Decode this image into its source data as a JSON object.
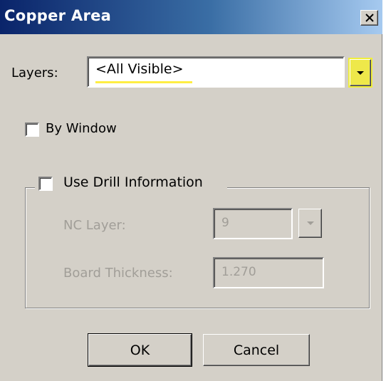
{
  "window": {
    "title": "Copper Area",
    "close_symbol": "×"
  },
  "layers": {
    "label": "Layers:",
    "value": "<All Visible>"
  },
  "by_window": {
    "label": "By Window",
    "checked": false
  },
  "drill_group": {
    "label": "Use Drill Information",
    "checked": false,
    "nc_layer": {
      "label": "NC Layer:",
      "value": "9"
    },
    "board_thickness": {
      "label": "Board Thickness:",
      "value": "1.270"
    }
  },
  "buttons": {
    "ok": "OK",
    "cancel": "Cancel"
  },
  "colors": {
    "face": "#d4d0c8",
    "title_start": "#0a246a",
    "title_end": "#a6caf0",
    "highlight": "#ffee44",
    "disabled_text": "#a19e98"
  },
  "icons": {
    "close": "close-icon",
    "dropdown": "chevron-down-icon"
  }
}
